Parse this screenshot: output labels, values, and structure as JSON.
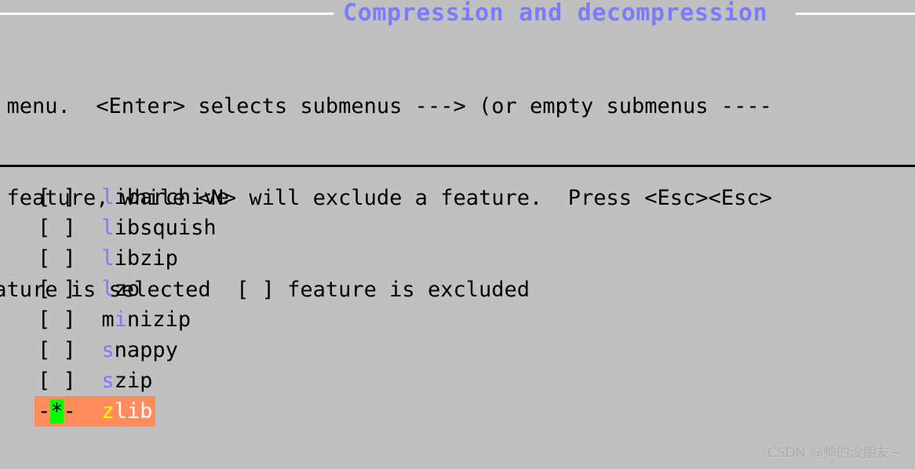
{
  "window": {
    "title": "Compression and decompression",
    "title_color": "#7b7bff",
    "background_color": "#c0c0c0",
    "border_color": "#ffffff",
    "separator_color": "#000000"
  },
  "help": {
    "lines": [
      "e menu.  <Enter> selects submenus ---> (or empty submenus ----",
      "a feature, while <N> will exclude a feature.  Press <Esc><Esc>",
      "eature is selected  [ ] feature is excluded"
    ]
  },
  "menu": {
    "selected_colors": {
      "background": "#ff8c5a",
      "star_background": "#00ff00",
      "key_color": "#ffff00",
      "text_color": "#ffffff"
    },
    "items": [
      {
        "marker_left": "[",
        "marker_mid": " ",
        "marker_right": "]",
        "gap": "  ",
        "pre": "",
        "key": "l",
        "post": "ibarchive",
        "selected": false
      },
      {
        "marker_left": "[",
        "marker_mid": " ",
        "marker_right": "]",
        "gap": "  ",
        "pre": "",
        "key": "l",
        "post": "ibsquish",
        "selected": false
      },
      {
        "marker_left": "[",
        "marker_mid": " ",
        "marker_right": "]",
        "gap": "  ",
        "pre": "",
        "key": "l",
        "post": "ibzip",
        "selected": false
      },
      {
        "marker_left": "[",
        "marker_mid": " ",
        "marker_right": "]",
        "gap": "  ",
        "pre": "",
        "key": "l",
        "post": "zo",
        "selected": false
      },
      {
        "marker_left": "[",
        "marker_mid": " ",
        "marker_right": "]",
        "gap": "  ",
        "pre": "m",
        "key": "i",
        "post": "nizip",
        "selected": false
      },
      {
        "marker_left": "[",
        "marker_mid": " ",
        "marker_right": "]",
        "gap": "  ",
        "pre": "",
        "key": "s",
        "post": "nappy",
        "selected": false
      },
      {
        "marker_left": "[",
        "marker_mid": " ",
        "marker_right": "]",
        "gap": "  ",
        "pre": "",
        "key": "s",
        "post": "zip",
        "selected": false
      },
      {
        "marker_left": "-",
        "marker_mid": "*",
        "marker_right": "-",
        "gap": "  ",
        "pre": "",
        "key": "z",
        "post": "lib",
        "selected": true
      }
    ]
  },
  "watermark": {
    "text": "CSDN @帅的没朋友~"
  }
}
